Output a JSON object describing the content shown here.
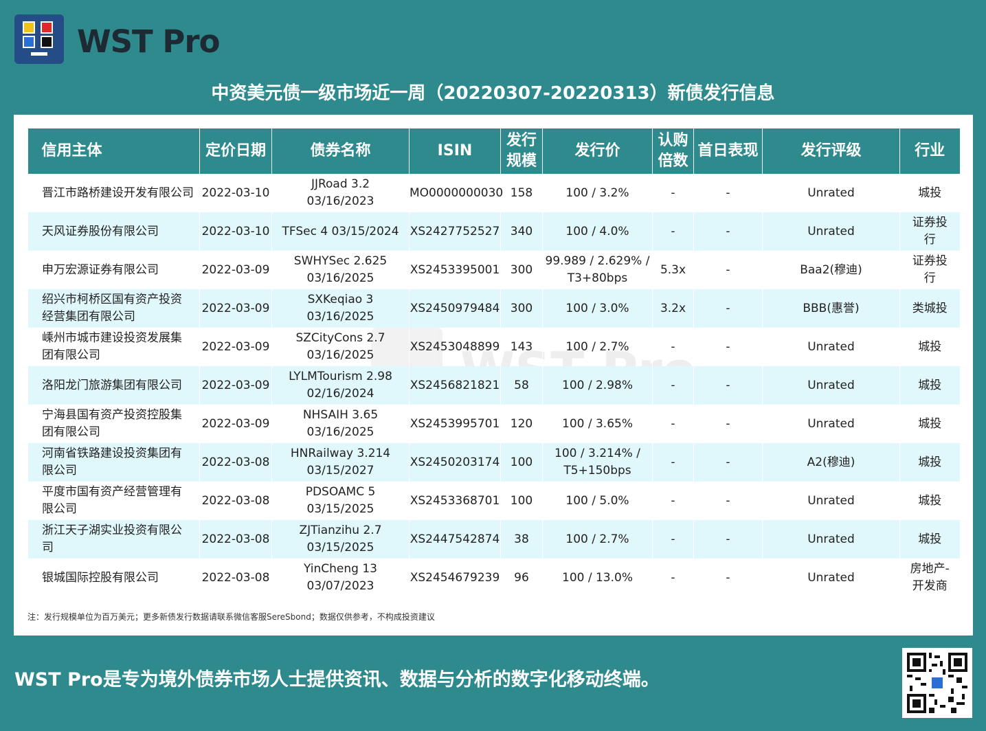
{
  "brand": {
    "name": "WST Pro",
    "logo_icon": "wst-logo-icon"
  },
  "title": "中资美元债一级市场近一周（20220307-20220313）新债发行信息",
  "table": {
    "headers": [
      "信用主体",
      "定价日期",
      "债券名称",
      "ISIN",
      "发行\n规模",
      "发行价",
      "认购\n倍数",
      "首日表现",
      "发行评级",
      "行业"
    ],
    "rows": [
      [
        "晋江市路桥建设开发有限公司",
        "2022-03-10",
        "JJRoad 3.2\n03/16/2023",
        "MO0000000030",
        "158",
        "100 / 3.2%",
        "-",
        "-",
        "Unrated",
        "城投"
      ],
      [
        "天风证券股份有限公司",
        "2022-03-10",
        "TFSec 4 03/15/2024",
        "XS2427752527",
        "340",
        "100 / 4.0%",
        "-",
        "-",
        "Unrated",
        "证券投\n行"
      ],
      [
        "申万宏源证券有限公司",
        "2022-03-09",
        "SWHYSec 2.625\n03/16/2025",
        "XS2453395001",
        "300",
        "99.989 / 2.629% /\nT3+80bps",
        "5.3x",
        "-",
        "Baa2(穆迪)",
        "证券投\n行"
      ],
      [
        "绍兴市柯桥区国有资产投资\n经营集团有限公司",
        "2022-03-09",
        "SXKeqiao 3\n03/16/2025",
        "XS2450979484",
        "300",
        "100 / 3.0%",
        "3.2x",
        "-",
        "BBB(惠誉)",
        "类城投"
      ],
      [
        "嵊州市城市建设投资发展集\n团有限公司",
        "2022-03-09",
        "SZCityCons 2.7\n03/16/2025",
        "XS2453048899",
        "143",
        "100 / 2.7%",
        "-",
        "-",
        "Unrated",
        "城投"
      ],
      [
        "洛阳龙门旅游集团有限公司",
        "2022-03-09",
        "LYLMTourism 2.98\n02/16/2024",
        "XS2456821821",
        "58",
        "100 / 2.98%",
        "-",
        "-",
        "Unrated",
        "城投"
      ],
      [
        "宁海县国有资产投资控股集\n团有限公司",
        "2022-03-09",
        "NHSAIH 3.65\n03/16/2025",
        "XS2453995701",
        "120",
        "100 / 3.65%",
        "-",
        "-",
        "Unrated",
        "城投"
      ],
      [
        "河南省铁路建设投资集团有\n限公司",
        "2022-03-08",
        "HNRailway 3.214\n03/15/2027",
        "XS2450203174",
        "100",
        "100 / 3.214% /\nT5+150bps",
        "-",
        "-",
        "A2(穆迪)",
        "城投"
      ],
      [
        "平度市国有资产经营管理有\n限公司",
        "2022-03-08",
        "PDSOAMC 5\n03/15/2025",
        "XS2453368701",
        "100",
        "100 / 5.0%",
        "-",
        "-",
        "Unrated",
        "城投"
      ],
      [
        "浙江天子湖实业投资有限公\n司",
        "2022-03-08",
        "ZJTianzihu 2.7\n03/15/2025",
        "XS2447542874",
        "38",
        "100 / 2.7%",
        "-",
        "-",
        "Unrated",
        "城投"
      ],
      [
        "银城国际控股有限公司",
        "2022-03-08",
        "YinCheng 13\n03/07/2023",
        "XS2454679239",
        "96",
        "100 / 13.0%",
        "-",
        "-",
        "Unrated",
        "房地产-\n开发商"
      ]
    ]
  },
  "note": "注：发行规模单位为百万美元；更多新债发行数据请联系微信客服SereSbond；数据仅供参考，不构成投资建议",
  "slogan": "WST Pro是专为境外债券市场人士提供资讯、数据与分析的数字化移动终端。",
  "watermark": "WST Pro",
  "colors": {
    "teal": "#2e8a8c",
    "row_alt": "#e0f7fb",
    "logo_bg": "#244d87"
  }
}
